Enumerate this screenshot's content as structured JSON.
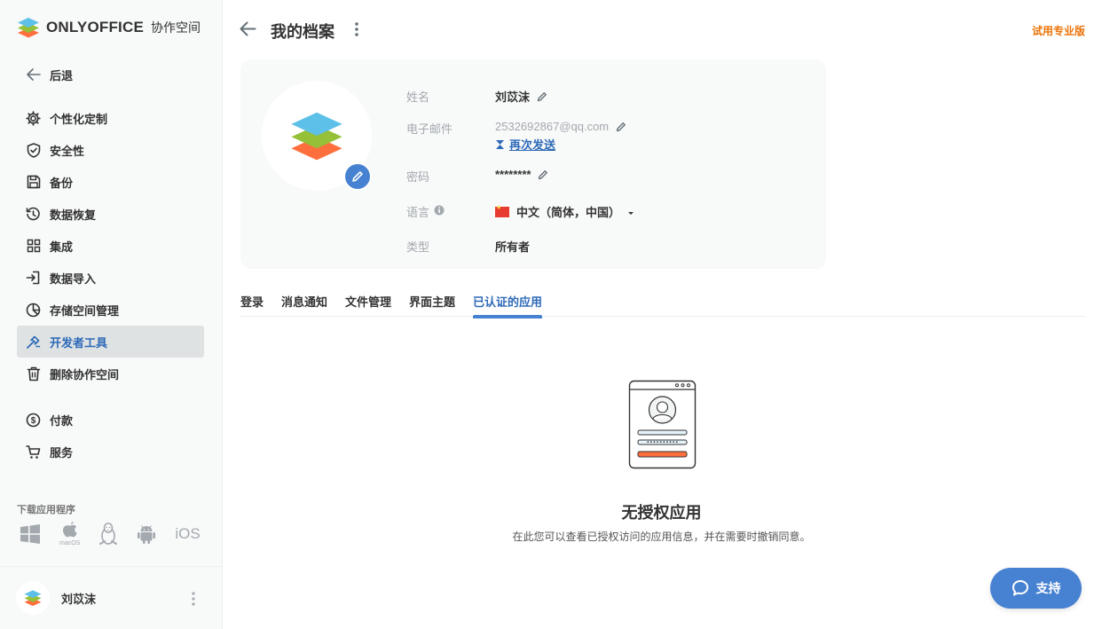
{
  "brand": {
    "name": "ONLYOFFICE",
    "sub": "协作空间"
  },
  "sidebar": {
    "back_label": "后退",
    "items": [
      {
        "label": "个性化定制",
        "icon": "gear-icon"
      },
      {
        "label": "安全性",
        "icon": "shield-icon"
      },
      {
        "label": "备份",
        "icon": "floppy-icon"
      },
      {
        "label": "数据恢复",
        "icon": "restore-icon"
      },
      {
        "label": "集成",
        "icon": "grid-icon"
      },
      {
        "label": "数据导入",
        "icon": "import-icon"
      },
      {
        "label": "存储空间管理",
        "icon": "pie-icon"
      },
      {
        "label": "开发者工具",
        "icon": "devtools-icon",
        "active": true
      },
      {
        "label": "删除协作空间",
        "icon": "trash-icon"
      }
    ],
    "payments_label": "付款",
    "services_label": "服务",
    "download_label": "下载应用程序",
    "download_os": [
      "windows-icon",
      "macos-icon",
      "linux-icon",
      "android-icon",
      "ios-icon"
    ],
    "macos_text": "macOS",
    "ios_text": "iOS",
    "user_name": "刘苡沫"
  },
  "header": {
    "title": "我的档案",
    "trial_label": "试用专业版"
  },
  "profile": {
    "name_label": "姓名",
    "name_value": "刘苡沫",
    "email_label": "电子邮件",
    "email_value": "2532692867@qq.com",
    "resend_label": "再次发送",
    "password_label": "密码",
    "password_value": "********",
    "language_label": "语言",
    "language_value": "中文（简体，中国）",
    "type_label": "类型",
    "type_value": "所有者"
  },
  "tabs": [
    {
      "label": "登录"
    },
    {
      "label": "消息通知"
    },
    {
      "label": "文件管理"
    },
    {
      "label": "界面主题"
    },
    {
      "label": "已认证的应用",
      "active": true
    }
  ],
  "empty": {
    "title": "无授权应用",
    "description": "在此您可以查看已授权访问的应用信息，并在需要时撤销同意。"
  },
  "support_label": "支持",
  "colors": {
    "accent": "#4781d1",
    "link": "#2d6ab8",
    "trial": "#ed7309",
    "logo_blue": "#5dc0e8",
    "logo_green": "#95c038",
    "logo_orange": "#ff6f3d"
  }
}
